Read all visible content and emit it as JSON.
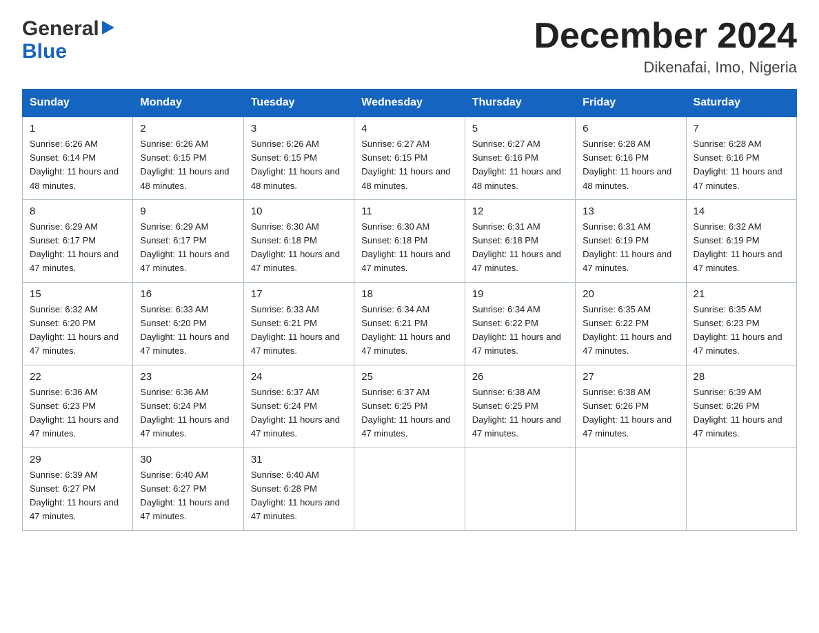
{
  "logo": {
    "line1": "General",
    "line2": "Blue",
    "arrow": "▶"
  },
  "title": "December 2024",
  "subtitle": "Dikenafai, Imo, Nigeria",
  "days": {
    "headers": [
      "Sunday",
      "Monday",
      "Tuesday",
      "Wednesday",
      "Thursday",
      "Friday",
      "Saturday"
    ]
  },
  "weeks": [
    [
      {
        "num": "1",
        "sunrise": "6:26 AM",
        "sunset": "6:14 PM",
        "daylight": "11 hours and 48 minutes."
      },
      {
        "num": "2",
        "sunrise": "6:26 AM",
        "sunset": "6:15 PM",
        "daylight": "11 hours and 48 minutes."
      },
      {
        "num": "3",
        "sunrise": "6:26 AM",
        "sunset": "6:15 PM",
        "daylight": "11 hours and 48 minutes."
      },
      {
        "num": "4",
        "sunrise": "6:27 AM",
        "sunset": "6:15 PM",
        "daylight": "11 hours and 48 minutes."
      },
      {
        "num": "5",
        "sunrise": "6:27 AM",
        "sunset": "6:16 PM",
        "daylight": "11 hours and 48 minutes."
      },
      {
        "num": "6",
        "sunrise": "6:28 AM",
        "sunset": "6:16 PM",
        "daylight": "11 hours and 48 minutes."
      },
      {
        "num": "7",
        "sunrise": "6:28 AM",
        "sunset": "6:16 PM",
        "daylight": "11 hours and 47 minutes."
      }
    ],
    [
      {
        "num": "8",
        "sunrise": "6:29 AM",
        "sunset": "6:17 PM",
        "daylight": "11 hours and 47 minutes."
      },
      {
        "num": "9",
        "sunrise": "6:29 AM",
        "sunset": "6:17 PM",
        "daylight": "11 hours and 47 minutes."
      },
      {
        "num": "10",
        "sunrise": "6:30 AM",
        "sunset": "6:18 PM",
        "daylight": "11 hours and 47 minutes."
      },
      {
        "num": "11",
        "sunrise": "6:30 AM",
        "sunset": "6:18 PM",
        "daylight": "11 hours and 47 minutes."
      },
      {
        "num": "12",
        "sunrise": "6:31 AM",
        "sunset": "6:18 PM",
        "daylight": "11 hours and 47 minutes."
      },
      {
        "num": "13",
        "sunrise": "6:31 AM",
        "sunset": "6:19 PM",
        "daylight": "11 hours and 47 minutes."
      },
      {
        "num": "14",
        "sunrise": "6:32 AM",
        "sunset": "6:19 PM",
        "daylight": "11 hours and 47 minutes."
      }
    ],
    [
      {
        "num": "15",
        "sunrise": "6:32 AM",
        "sunset": "6:20 PM",
        "daylight": "11 hours and 47 minutes."
      },
      {
        "num": "16",
        "sunrise": "6:33 AM",
        "sunset": "6:20 PM",
        "daylight": "11 hours and 47 minutes."
      },
      {
        "num": "17",
        "sunrise": "6:33 AM",
        "sunset": "6:21 PM",
        "daylight": "11 hours and 47 minutes."
      },
      {
        "num": "18",
        "sunrise": "6:34 AM",
        "sunset": "6:21 PM",
        "daylight": "11 hours and 47 minutes."
      },
      {
        "num": "19",
        "sunrise": "6:34 AM",
        "sunset": "6:22 PM",
        "daylight": "11 hours and 47 minutes."
      },
      {
        "num": "20",
        "sunrise": "6:35 AM",
        "sunset": "6:22 PM",
        "daylight": "11 hours and 47 minutes."
      },
      {
        "num": "21",
        "sunrise": "6:35 AM",
        "sunset": "6:23 PM",
        "daylight": "11 hours and 47 minutes."
      }
    ],
    [
      {
        "num": "22",
        "sunrise": "6:36 AM",
        "sunset": "6:23 PM",
        "daylight": "11 hours and 47 minutes."
      },
      {
        "num": "23",
        "sunrise": "6:36 AM",
        "sunset": "6:24 PM",
        "daylight": "11 hours and 47 minutes."
      },
      {
        "num": "24",
        "sunrise": "6:37 AM",
        "sunset": "6:24 PM",
        "daylight": "11 hours and 47 minutes."
      },
      {
        "num": "25",
        "sunrise": "6:37 AM",
        "sunset": "6:25 PM",
        "daylight": "11 hours and 47 minutes."
      },
      {
        "num": "26",
        "sunrise": "6:38 AM",
        "sunset": "6:25 PM",
        "daylight": "11 hours and 47 minutes."
      },
      {
        "num": "27",
        "sunrise": "6:38 AM",
        "sunset": "6:26 PM",
        "daylight": "11 hours and 47 minutes."
      },
      {
        "num": "28",
        "sunrise": "6:39 AM",
        "sunset": "6:26 PM",
        "daylight": "11 hours and 47 minutes."
      }
    ],
    [
      {
        "num": "29",
        "sunrise": "6:39 AM",
        "sunset": "6:27 PM",
        "daylight": "11 hours and 47 minutes."
      },
      {
        "num": "30",
        "sunrise": "6:40 AM",
        "sunset": "6:27 PM",
        "daylight": "11 hours and 47 minutes."
      },
      {
        "num": "31",
        "sunrise": "6:40 AM",
        "sunset": "6:28 PM",
        "daylight": "11 hours and 47 minutes."
      },
      null,
      null,
      null,
      null
    ]
  ],
  "labels": {
    "sunrise": "Sunrise:",
    "sunset": "Sunset:",
    "daylight": "Daylight:"
  }
}
